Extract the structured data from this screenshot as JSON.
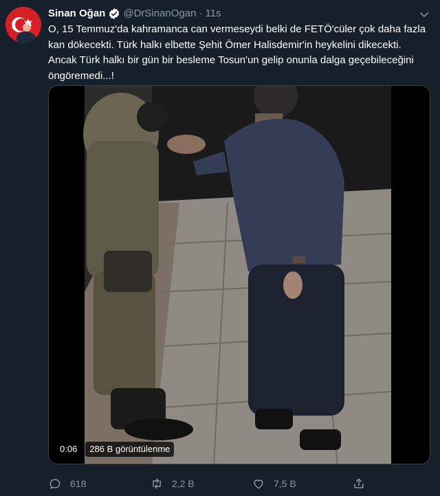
{
  "tweet": {
    "author_name": "Sinan Oğan",
    "handle": "@DrSinanOgan",
    "separator": "·",
    "time": "11s",
    "text": "O, 15 Temmuz'da kahramanca can vermeseydi belki de FETÖ'cüler çok daha fazla kan dökecekti. Türk halkı elbette Şehit Ömer Halisdemir'in heykelini dikecekti. Ancak Türk halkı bir gün bir besleme Tosun'un gelip onunla dalga geçebileceğini öngöremedi...!"
  },
  "video": {
    "duration": "0:06",
    "views": "286 B görüntülenme"
  },
  "actions": {
    "reply_count": "618",
    "retweet_count": "2,2 B",
    "like_count": "7,5 B"
  },
  "icons": {
    "verified": "verified-badge-icon",
    "more": "chevron-down-icon",
    "reply": "reply-icon",
    "retweet": "retweet-icon",
    "like": "heart-icon",
    "share": "share-icon"
  },
  "colors": {
    "background": "#15202b",
    "secondary_text": "#8899a6",
    "verified": "#ffffff",
    "avatar_flag": "#d61f26"
  }
}
